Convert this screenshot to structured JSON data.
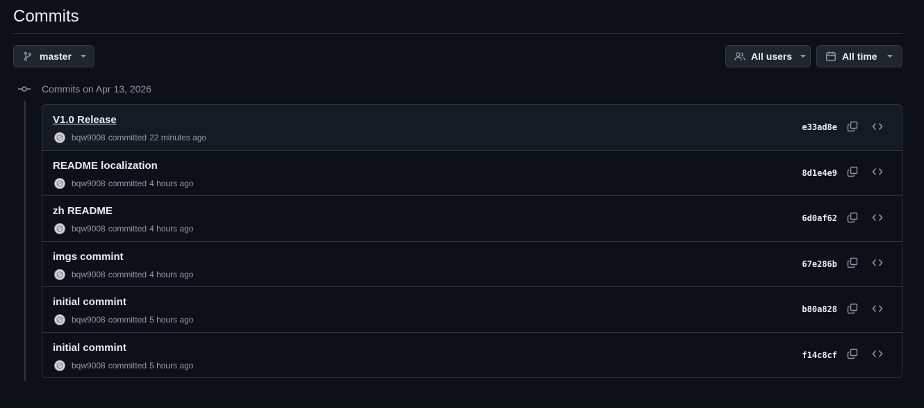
{
  "page": {
    "title": "Commits"
  },
  "filters": {
    "branch": {
      "label": "master",
      "icon": "git-branch-icon"
    },
    "users": {
      "label": "All users",
      "icon": "people-icon"
    },
    "time": {
      "label": "All time",
      "icon": "calendar-icon"
    }
  },
  "group": {
    "date_label": "Commits on Apr 13, 2026"
  },
  "commits": [
    {
      "message": "V1.0 Release",
      "author": "bqw9008",
      "verb": "committed",
      "when": "22 minutes ago",
      "sha": "e33ad8e"
    },
    {
      "message": "README localization",
      "author": "bqw9008",
      "verb": "committed",
      "when": "4 hours ago",
      "sha": "8d1e4e9"
    },
    {
      "message": "zh README",
      "author": "bqw9008",
      "verb": "committed",
      "when": "4 hours ago",
      "sha": "6d0af62"
    },
    {
      "message": "imgs commint",
      "author": "bqw9008",
      "verb": "committed",
      "when": "4 hours ago",
      "sha": "67e286b"
    },
    {
      "message": "initial commint",
      "author": "bqw9008",
      "verb": "committed",
      "when": "5 hours ago",
      "sha": "b80a828"
    },
    {
      "message": "initial commint",
      "author": "bqw9008",
      "verb": "committed",
      "when": "5 hours ago",
      "sha": "f14c8cf"
    }
  ],
  "colors": {
    "background": "#0d1117",
    "border": "#30363d",
    "muted": "#9198a1",
    "text": "#e6edf3",
    "button_bg": "#21262d"
  }
}
